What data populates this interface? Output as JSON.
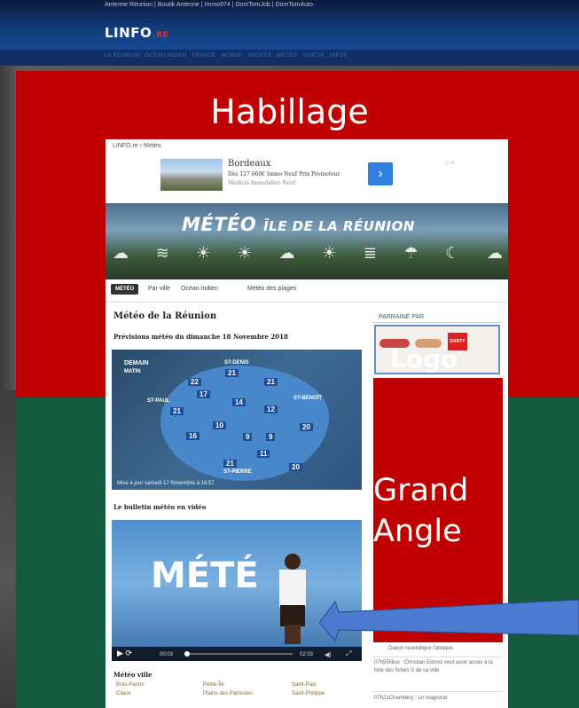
{
  "site": {
    "network_links": "Antenne Réunion | Boutik Antenne | Immo974 | DomTomJob | DomTomAuto",
    "logo_text": "LINFO",
    "logo_suffix": ".RE",
    "nav_items": "LA RÉUNION · OCÉAN INDIEN · FRANCE · MONDE · SPORTS · MÉTÉO · VIDÉOS · INFOS"
  },
  "annotations": {
    "habillage": "Habillage",
    "logo": "Logo",
    "grand_angle_1": "Grand",
    "grand_angle_2": "Angle",
    "arrow_color": "#4a7bd0"
  },
  "page": {
    "breadcrumb": "LINFO.re  ›  Météo",
    "ad": {
      "title": "Bordeaux",
      "line": "Dès 127 660€  Immo Neuf Prix Promoteur",
      "sub": "Médicis-Immobilier-Neuf",
      "arrow": "›",
      "choice": "ⓘ ✕"
    },
    "banner": {
      "title_big": "MÉTÉO",
      "title_small": "ÎLE DE LA RÉUNION"
    },
    "weather_icons": [
      "☁",
      "≋",
      "☀",
      "☀",
      "☁",
      "☀",
      "≣",
      "☂",
      "☾",
      "☁"
    ],
    "tabs": {
      "active": "MÉTÉO",
      "items": [
        "Par ville",
        "Océan Indien",
        "Météo des plages"
      ]
    },
    "title": "Météo de la Réunion",
    "subtitle": "Prévisions météo du dimanche 18 Novembre 2018",
    "map": {
      "header": "DEMAIN",
      "header_sub": "MATIN",
      "labels": [
        "ST-DENIS",
        "ST-PAUL",
        "ST-BENOÎT",
        "ST-PIERRE"
      ],
      "temps": [
        "22",
        "21",
        "17",
        "21",
        "14",
        "12",
        "21",
        "10",
        "20",
        "16",
        "9",
        "9",
        "11",
        "21",
        "20"
      ],
      "update": "Mise à jour samedi 17 Novembre à 16:57"
    },
    "video": {
      "title": "Le bulletin météo en vidéo",
      "word": "MÉTÉ",
      "time": "00:03",
      "duration": "02:03"
    },
    "cities": {
      "title": "Météo ville",
      "col1": [
        "Bras-Panon",
        "Cilaos"
      ],
      "col2": [
        "Petite-Île",
        "Plaine des Palmistes"
      ],
      "col3": [
        "Saint-Paul",
        "Saint-Philippe"
      ]
    },
    "sidebar": {
      "sponsor_label": "PARRAINÉ PAR",
      "darty": "DARTY",
      "news": [
        "Daech revendique l'attaque",
        "07h55Nice : Christian Estrosi veut avoir accès à la liste des fichés S de sa ville",
        "07h21Chambéry : un magistrat"
      ]
    }
  }
}
